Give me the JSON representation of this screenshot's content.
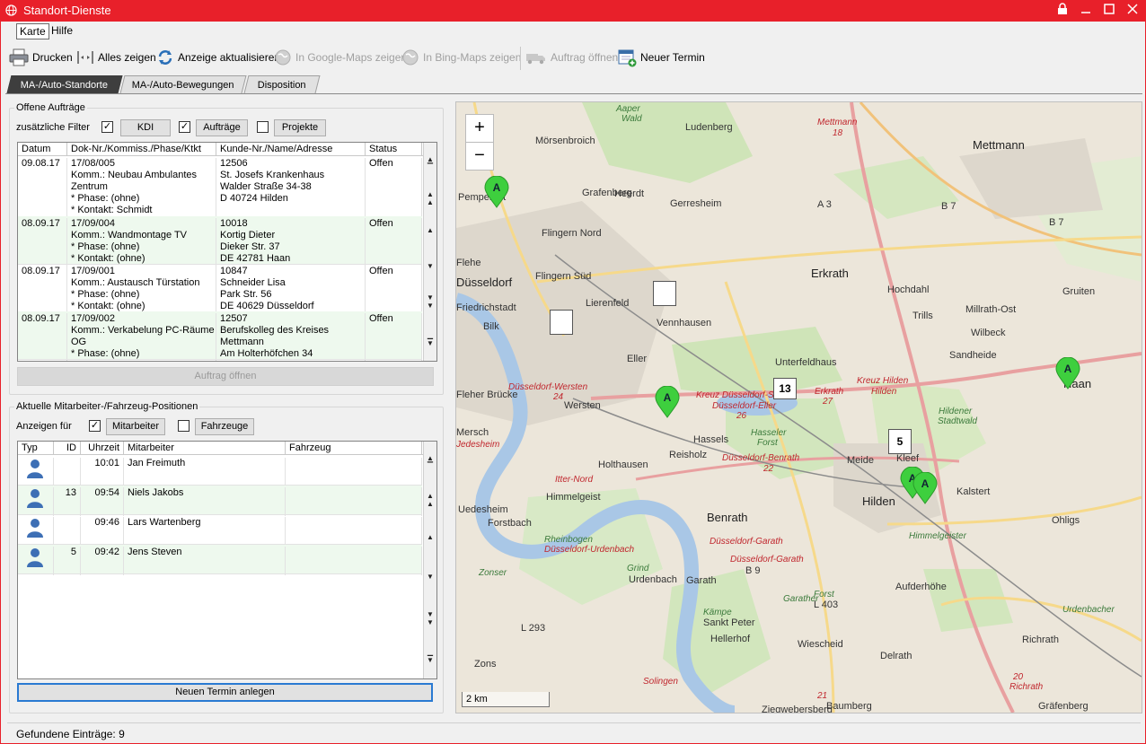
{
  "window": {
    "title": "Standort-Dienste"
  },
  "menu": {
    "items": [
      "Karte",
      "Hilfe"
    ]
  },
  "toolbar": {
    "print": "Drucken",
    "show_all": "Alles zeigen",
    "refresh": "Anzeige aktualisieren",
    "google_maps": "In Google-Maps zeigen",
    "bing_maps": "In Bing-Maps zeigen",
    "open_order": "Auftrag öffnen",
    "new_appointment": "Neuer Termin"
  },
  "tabs": [
    "MA-/Auto-Standorte",
    "MA-/Auto-Bewegungen",
    "Disposition"
  ],
  "orders_panel": {
    "title": "Offene Aufträge",
    "filter_label": "zusätzliche Filter",
    "filters": [
      {
        "label": "KDI",
        "checked": true
      },
      {
        "label": "Aufträge",
        "checked": true
      },
      {
        "label": "Projekte",
        "checked": false
      }
    ],
    "columns": [
      "Datum",
      "Dok-Nr./Kommiss./Phase/Ktkt",
      "Kunde-Nr./Name/Adresse",
      "Status"
    ],
    "rows": [
      {
        "date": "09.08.17",
        "doc": [
          "17/08/005",
          "Komm.: Neubau Ambulantes",
          "Zentrum",
          "* Phase: (ohne)",
          "* Kontakt: Schmidt"
        ],
        "customer": [
          "12506",
          "St. Josefs Krankenhaus",
          "Walder Straße 34-38",
          "D 40724 Hilden"
        ],
        "status": "Offen"
      },
      {
        "date": "08.09.17",
        "doc": [
          "17/09/004",
          "Komm.: Wandmontage TV",
          "* Phase: (ohne)",
          "* Kontakt: (ohne)"
        ],
        "customer": [
          "10018",
          "Kortig Dieter",
          "Dieker Str. 37",
          "DE 42781 Haan"
        ],
        "status": "Offen"
      },
      {
        "date": "08.09.17",
        "doc": [
          "17/09/001",
          "Komm.: Austausch Türstation",
          "* Phase: (ohne)",
          "* Kontakt: (ohne)"
        ],
        "customer": [
          "10847",
          "Schneider Lisa",
          "Park Str. 56",
          "DE 40629 Düsseldorf"
        ],
        "status": "Offen"
      },
      {
        "date": "08.09.17",
        "doc": [
          "17/09/002",
          "Komm.: Verkabelung PC-Räume",
          "OG",
          "* Phase: (ohne)"
        ],
        "customer": [
          "12507",
          "Berufskolleg des Kreises",
          "Mettmann",
          "Am Holterhöfchen 34"
        ],
        "status": "Offen"
      }
    ],
    "open_button": "Auftrag öffnen"
  },
  "staff_panel": {
    "title": "Aktuelle Mitarbeiter-/Fahrzeug-Positionen",
    "show_for_label": "Anzeigen für",
    "filters": [
      {
        "label": "Mitarbeiter",
        "checked": true
      },
      {
        "label": "Fahrzeuge",
        "checked": false
      }
    ],
    "columns": [
      "Typ",
      "ID",
      "Uhrzeit",
      "Mitarbeiter",
      "Fahrzeug"
    ],
    "rows": [
      {
        "type": "person-icon",
        "id": "",
        "time": "10:01",
        "name": "Jan Freimuth",
        "vehicle": ""
      },
      {
        "type": "person-icon",
        "id": "13",
        "time": "09:54",
        "name": "Niels Jakobs",
        "vehicle": ""
      },
      {
        "type": "person-icon",
        "id": "",
        "time": "09:46",
        "name": "Lars Wartenberg",
        "vehicle": ""
      },
      {
        "type": "person-icon",
        "id": "5",
        "time": "09:42",
        "name": "Jens Steven",
        "vehicle": ""
      }
    ],
    "new_appointment_button": "Neuen Termin anlegen"
  },
  "map": {
    "zoom_in": "+",
    "zoom_out": "−",
    "scale": "2 km",
    "labels": [
      {
        "t": "Aaper",
        "c": "green"
      },
      {
        "t": "Wald",
        "c": "green"
      },
      {
        "t": "Mörsenbroich",
        "c": ""
      },
      {
        "t": "Ludenberg",
        "c": ""
      },
      {
        "t": "Mettmann",
        "c": "red"
      },
      {
        "t": "18",
        "c": "red"
      },
      {
        "t": "Mettmann",
        "c": "big"
      },
      {
        "t": "Pempelfort",
        "c": ""
      },
      {
        "t": "Grafenberg",
        "c": ""
      },
      {
        "t": "Gerresheim",
        "c": ""
      },
      {
        "t": "Flingern Nord",
        "c": ""
      },
      {
        "t": "A 3",
        "c": ""
      },
      {
        "t": "B 7",
        "c": ""
      },
      {
        "t": "B 7",
        "c": ""
      },
      {
        "t": "Düsseldorf",
        "c": "big"
      },
      {
        "t": "Flingern Süd",
        "c": ""
      },
      {
        "t": "Erkrath",
        "c": "big"
      },
      {
        "t": "Hochdahl",
        "c": ""
      },
      {
        "t": "Gruiten",
        "c": ""
      },
      {
        "t": "Friedrichstadt",
        "c": ""
      },
      {
        "t": "Lierenfeld",
        "c": ""
      },
      {
        "t": "Vennhausen",
        "c": ""
      },
      {
        "t": "Trills",
        "c": ""
      },
      {
        "t": "Millrath-Ost",
        "c": ""
      },
      {
        "t": "Wilbeck",
        "c": ""
      },
      {
        "t": "Bilk",
        "c": ""
      },
      {
        "t": "Eller",
        "c": ""
      },
      {
        "t": "Unterfeldhaus",
        "c": ""
      },
      {
        "t": "Sandheide",
        "c": ""
      },
      {
        "t": "Düsseldorf-Wersten",
        "c": "red"
      },
      {
        "t": "24",
        "c": "red"
      },
      {
        "t": "Wersten",
        "c": ""
      },
      {
        "t": "Kreuz Düsseldorf-Süd",
        "c": "red"
      },
      {
        "t": "Düsseldorf-Eller",
        "c": "red"
      },
      {
        "t": "26",
        "c": "red"
      },
      {
        "t": "Erkrath",
        "c": "red"
      },
      {
        "t": "27",
        "c": "red"
      },
      {
        "t": "Kreuz Hilden",
        "c": "red"
      },
      {
        "t": "Hilden",
        "c": "red"
      },
      {
        "t": "Haan",
        "c": "big"
      },
      {
        "t": "Hassels",
        "c": ""
      },
      {
        "t": "Hasseler",
        "c": "green"
      },
      {
        "t": "Forst",
        "c": "green"
      },
      {
        "t": "Hildener",
        "c": "green"
      },
      {
        "t": "Stadtwald",
        "c": "green"
      },
      {
        "t": "Itter-Nord",
        "c": "red"
      },
      {
        "t": "Holthausen",
        "c": ""
      },
      {
        "t": "Reisholz",
        "c": ""
      },
      {
        "t": "Düsseldorf-Benrath",
        "c": "red"
      },
      {
        "t": "22",
        "c": "red"
      },
      {
        "t": "Meide",
        "c": ""
      },
      {
        "t": "Kleef",
        "c": ""
      },
      {
        "t": "Hilden",
        "c": "big"
      },
      {
        "t": "Kalstert",
        "c": ""
      },
      {
        "t": "Himmelgeist",
        "c": ""
      },
      {
        "t": "Benrath",
        "c": "big"
      },
      {
        "t": "Ohligs",
        "c": ""
      },
      {
        "t": "Uedesheim",
        "c": ""
      },
      {
        "t": "Forstbach",
        "c": ""
      },
      {
        "t": "Himmelgeister",
        "c": "green"
      },
      {
        "t": "Rheinbogen",
        "c": "green"
      },
      {
        "t": "Düsseldorf-Urdenbach",
        "c": "red"
      },
      {
        "t": "Düsseldorf-Garath",
        "c": "red"
      },
      {
        "t": "Düsseldorf-Garath",
        "c": "red"
      },
      {
        "t": "B 9",
        "c": ""
      },
      {
        "t": "Zonser",
        "c": "green"
      },
      {
        "t": "Grind",
        "c": "green"
      },
      {
        "t": "Urdenbach",
        "c": ""
      },
      {
        "t": "Garath",
        "c": ""
      },
      {
        "t": "Garather",
        "c": "green"
      },
      {
        "t": "Forst",
        "c": "green"
      },
      {
        "t": "L 403",
        "c": ""
      },
      {
        "t": "Aufderhöhe",
        "c": ""
      },
      {
        "t": "Urdenbacher",
        "c": "green"
      },
      {
        "t": "Kämpe",
        "c": "green"
      },
      {
        "t": "Sankt Peter",
        "c": ""
      },
      {
        "t": "L 293",
        "c": ""
      },
      {
        "t": "Hellerhof",
        "c": ""
      },
      {
        "t": "Wiescheid",
        "c": ""
      },
      {
        "t": "Richrath",
        "c": ""
      },
      {
        "t": "Delrath",
        "c": ""
      },
      {
        "t": "Zons",
        "c": ""
      },
      {
        "t": "Solingen",
        "c": "red"
      },
      {
        "t": "20",
        "c": "red"
      },
      {
        "t": "Richrath",
        "c": "red"
      },
      {
        "t": "21",
        "c": "red"
      },
      {
        "t": "Baumberg",
        "c": ""
      },
      {
        "t": "Ziegwebersberg",
        "c": ""
      },
      {
        "t": "Gräfenberg",
        "c": ""
      },
      {
        "t": "Heerdt",
        "c": ""
      },
      {
        "t": "Flehe",
        "c": ""
      },
      {
        "t": "Fleher Brücke",
        "c": ""
      },
      {
        "t": "Mersch",
        "c": ""
      },
      {
        "t": "Jedesheim",
        "c": "red"
      }
    ],
    "pins": [
      {
        "label": "A"
      },
      {
        "label": "A"
      },
      {
        "label": "A"
      },
      {
        "label": "A"
      },
      {
        "label": "A"
      }
    ],
    "flags": [
      {
        "label": ""
      },
      {
        "label": ""
      },
      {
        "label": "13"
      },
      {
        "label": "5"
      }
    ]
  },
  "status": {
    "found": "Gefundene Einträge: 9"
  },
  "colors": {
    "accent_red": "#e8202a",
    "pin_green": "#3ecf3e",
    "row_alt": "#eef9ee"
  }
}
